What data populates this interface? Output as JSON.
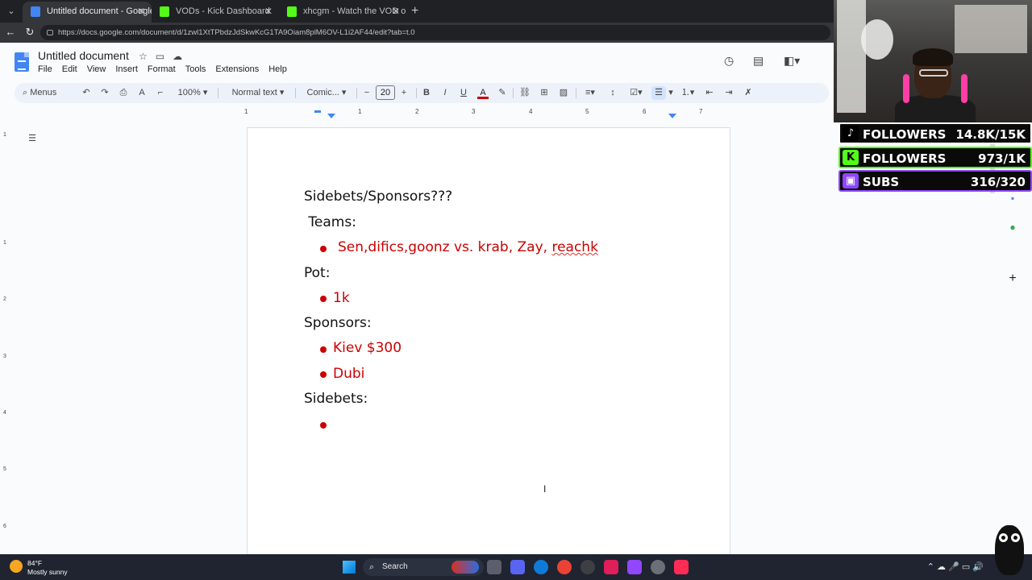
{
  "browser": {
    "tabs": [
      {
        "title": "Untitled document - Google Docs",
        "active": true
      },
      {
        "title": "VODs - Kick Dashboard",
        "active": false
      },
      {
        "title": "xhcgm - Watch the VOD on Kick",
        "active": false
      }
    ],
    "url": "https://docs.google.com/document/d/1zwl1XtTPbdzJdSkwKcG1TA9Oiam8plM6OV-L1i2AF44/edit?tab=t.0"
  },
  "docs": {
    "title": "Untitled document",
    "menu": [
      "File",
      "Edit",
      "View",
      "Insert",
      "Format",
      "Tools",
      "Extensions",
      "Help"
    ],
    "toolbar": {
      "menus_label": "Menus",
      "zoom": "100%",
      "style": "Normal text",
      "font": "Comic...",
      "font_size": "20"
    },
    "ruler_numbers": [
      "1",
      "1",
      "2",
      "3",
      "4",
      "5",
      "6",
      "7"
    ],
    "vruler_numbers": [
      "1",
      "1",
      "2",
      "3",
      "4",
      "5",
      "6"
    ]
  },
  "document": {
    "line1": "Sidebets/Sponsors???",
    "line2": " Teams:",
    "teams_item_a": "Sen,difics,goonz vs. krab, Zay, ",
    "teams_item_b": "reachk",
    "pot_label": "Pot:",
    "pot_item": "1k",
    "sponsors_label": "Sponsors:",
    "sponsor_1": "Kiev $300",
    "sponsor_2": "Dubi",
    "sidebets_label": "Sidebets:"
  },
  "stream_overlay": {
    "tiktok": {
      "label": "FOLLOWERS",
      "value": "14.8K/15K",
      "color": "#ffffff"
    },
    "kick": {
      "label": "FOLLOWERS",
      "value": "973/1K",
      "color": "#53fc18"
    },
    "twitch": {
      "label": "SUBS",
      "value": "316/320",
      "color": "#9146ff"
    }
  },
  "taskbar": {
    "temperature": "84°F",
    "condition": "Mostly sunny",
    "search_label": "Search"
  }
}
